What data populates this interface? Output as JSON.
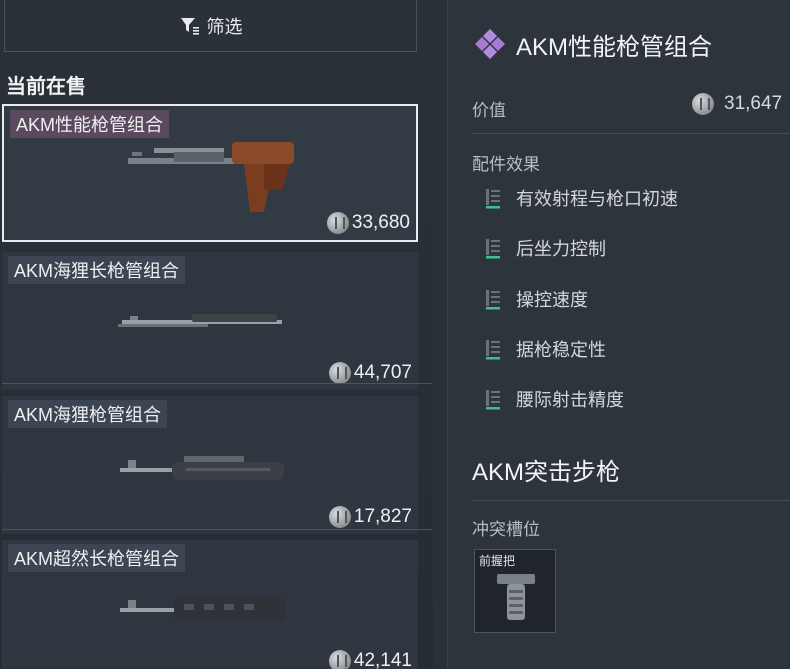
{
  "filter": {
    "label": "筛选",
    "icon": "filter-icon"
  },
  "listing": {
    "section_title": "当前在售",
    "items": [
      {
        "name": "AKM性能枪管组合",
        "price": "33,680",
        "selected": true
      },
      {
        "name": "AKM海狸长枪管组合",
        "price": "44,707",
        "selected": false
      },
      {
        "name": "AKM海狸枪管组合",
        "price": "17,827",
        "selected": false
      },
      {
        "name": "AKM超然长枪管组合",
        "price": "42,141",
        "selected": false
      }
    ]
  },
  "detail": {
    "title": "AKM性能枪管组合",
    "value_label": "价值",
    "value": "31,647",
    "effects_label": "配件效果",
    "effects": [
      "有效射程与枪口初速",
      "后坐力控制",
      "操控速度",
      "据枪稳定性",
      "腰际射击精度"
    ],
    "weapon_title": "AKM突击步枪",
    "conflict_label": "冲突槽位",
    "conflict_slot": "前握把"
  },
  "colors": {
    "accent_purple": "#b48ae0",
    "effect_green": "#3fbf8a"
  }
}
